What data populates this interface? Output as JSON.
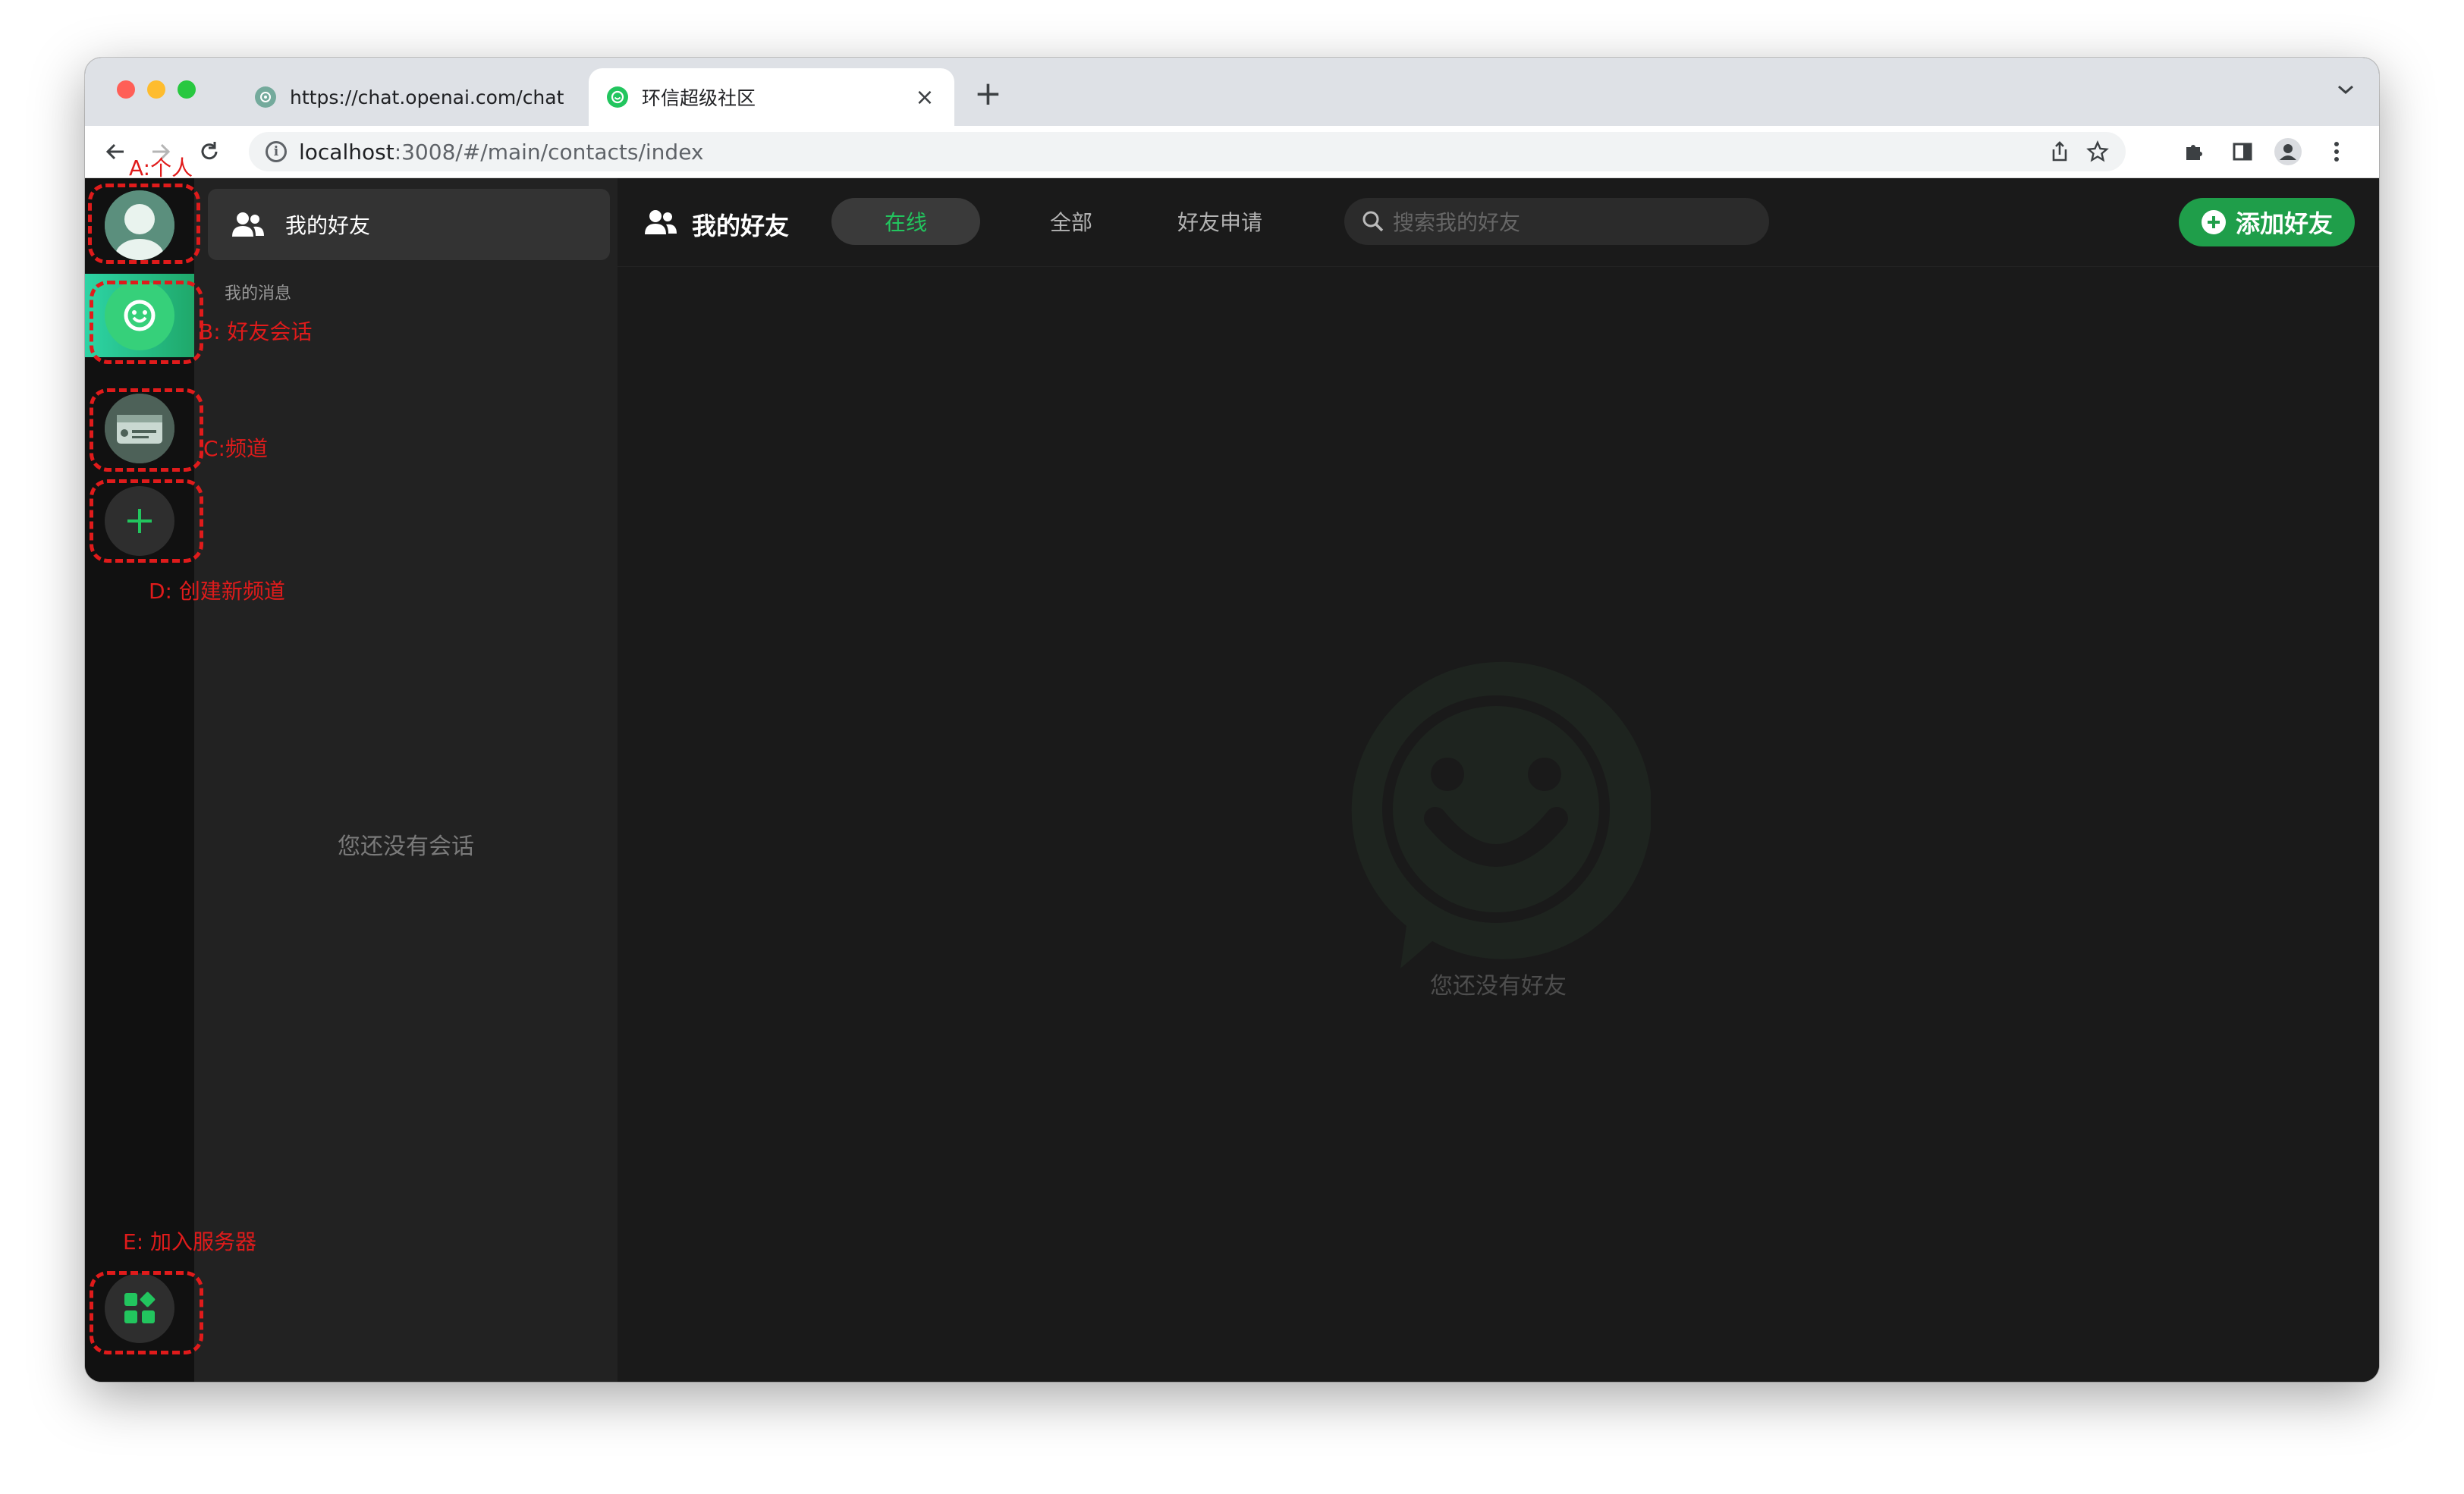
{
  "browser": {
    "tabs": [
      {
        "title": "https://chat.openai.com/chat",
        "active": false,
        "favicon": "openai-icon"
      },
      {
        "title": "环信超级社区",
        "active": true,
        "favicon": "huanxin-logo-icon"
      }
    ],
    "address": {
      "host": "localhost",
      "path": ":3008/#/main/contacts/index"
    }
  },
  "sidebar": {
    "header_label": "我的好友",
    "section_label": "我的消息",
    "empty_text": "您还没有会话"
  },
  "main": {
    "title": "我的好友",
    "tabs": [
      {
        "label": "在线",
        "active": true
      },
      {
        "label": "全部",
        "active": false
      },
      {
        "label": "好友申请",
        "active": false
      }
    ],
    "search_placeholder": "搜索我的好友",
    "add_button_label": "添加好友",
    "empty_text": "您还没有好友"
  },
  "annotations": {
    "a": "A:个人",
    "b": "B: 好友会话",
    "c": "C:频道",
    "d": "D: 创建新频道",
    "e": "E: 加入服务器"
  },
  "colors": {
    "accent": "#22c55e",
    "annotation": "#e01b1b",
    "rail_background": "#111111",
    "sidebar_background": "#222222",
    "main_background": "#1a1a1a"
  }
}
